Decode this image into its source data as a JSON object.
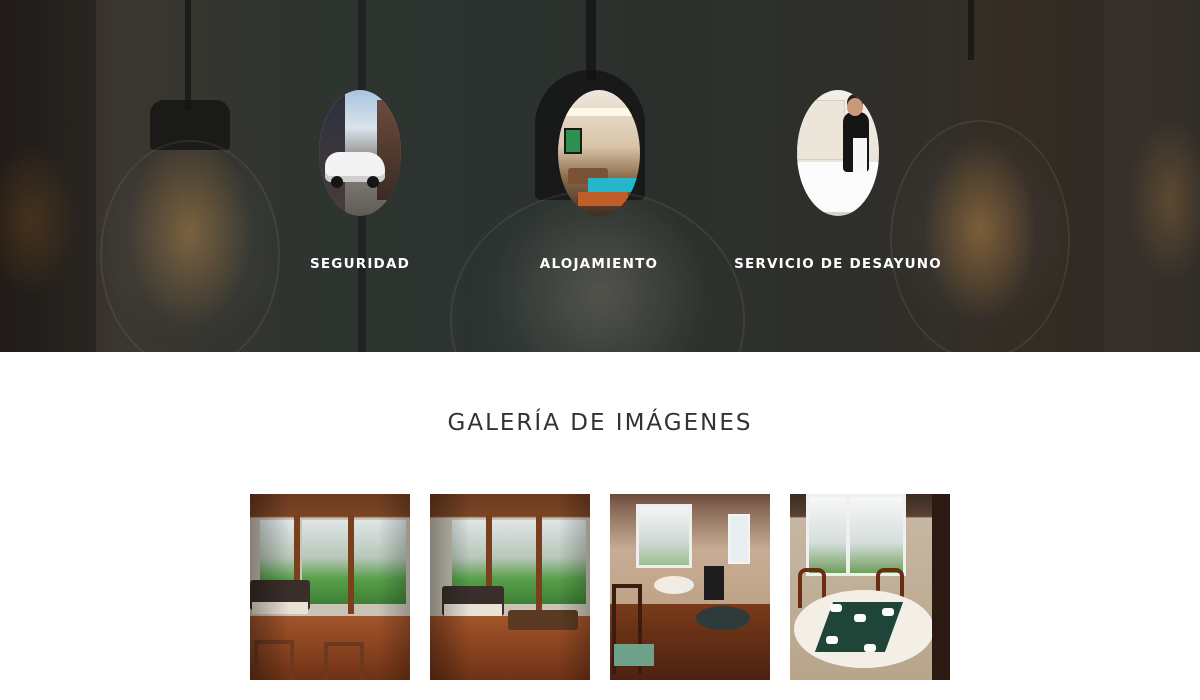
{
  "services": [
    {
      "id": "seguridad",
      "label": "SEGURIDAD",
      "image_alt": "Calle con auto blanco"
    },
    {
      "id": "alojamiento",
      "label": "ALOJAMIENTO",
      "image_alt": "Sala de estar con piscina"
    },
    {
      "id": "desayuno",
      "label": "SERVICIO DE DESAYUNO",
      "image_alt": "Mucama preparando cama"
    }
  ],
  "gallery": {
    "title": "GALERÍA DE IMÁGENES",
    "photos": [
      {
        "id": "sunroom-1",
        "alt": "Sala con ventanal al jardín"
      },
      {
        "id": "sunroom-2",
        "alt": "Sala con ventanal al jardín"
      },
      {
        "id": "dining-1",
        "alt": "Comedor con estufa"
      },
      {
        "id": "dining-2",
        "alt": "Mesa de desayuno"
      }
    ]
  },
  "colors": {
    "hero_overlay": "#2e302c",
    "label_text": "#ffffff",
    "title_text": "#333333",
    "page_background": "#ffffff"
  }
}
